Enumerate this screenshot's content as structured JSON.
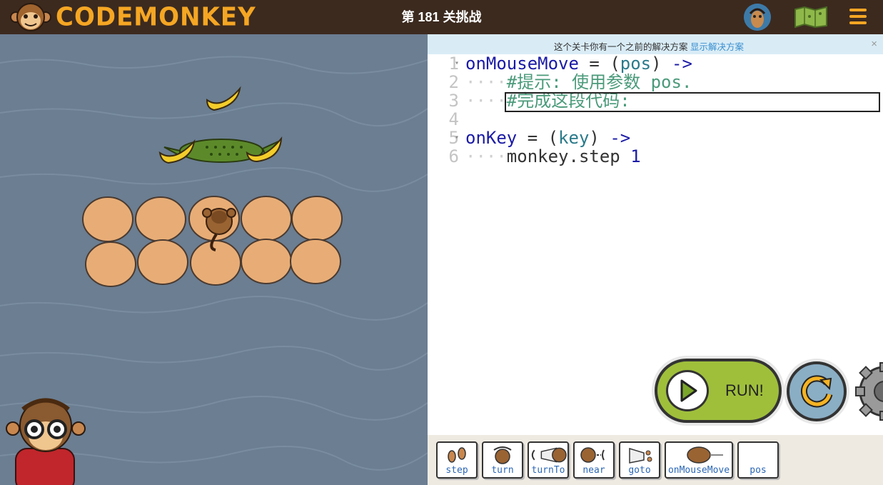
{
  "header": {
    "logo_text": "CODEMONKEY",
    "level_title": "第 181 关挑战",
    "icons": [
      "monkey-logo-icon",
      "profile-avatar-icon",
      "map-icon",
      "menu-icon"
    ],
    "accent_color": "#f5a623",
    "bar_color": "#3c2a1f"
  },
  "notice": {
    "message": "这个关卡你有一个之前的解决方案",
    "link": "显示解决方案",
    "close": "×"
  },
  "editor": {
    "lines": [
      {
        "num": "1",
        "fold": true,
        "parts": [
          [
            "onMouseMove",
            "kw-fn"
          ],
          [
            " = ",
            "op"
          ],
          [
            "(",
            "op"
          ],
          [
            "pos",
            "kw-par"
          ],
          [
            ")",
            "op"
          ],
          [
            " ",
            "op"
          ],
          [
            "->",
            "arrow"
          ]
        ]
      },
      {
        "num": "2",
        "fold": false,
        "parts": [
          [
            "····",
            "ws"
          ],
          [
            "#提示: 使用参数 pos.",
            "cm"
          ]
        ]
      },
      {
        "num": "3",
        "fold": false,
        "parts": [
          [
            "····",
            "ws"
          ],
          [
            "#完成这段代码:",
            "cm"
          ]
        ]
      },
      {
        "num": "4",
        "fold": false,
        "parts": []
      },
      {
        "num": "5",
        "fold": true,
        "parts": [
          [
            "onKey",
            "kw-fn"
          ],
          [
            " = ",
            "op"
          ],
          [
            "(",
            "op"
          ],
          [
            "key",
            "kw-par"
          ],
          [
            ")",
            "op"
          ],
          [
            " ",
            "op"
          ],
          [
            "->",
            "arrow"
          ]
        ]
      },
      {
        "num": "6",
        "fold": false,
        "parts": [
          [
            "····",
            "ws"
          ],
          [
            "monkey.step ",
            "op"
          ],
          [
            "1",
            "num"
          ]
        ]
      }
    ]
  },
  "controls": {
    "run_label": "RUN!",
    "run_color": "#9fbf3b",
    "reset_color": "#8aaec4"
  },
  "tray": {
    "tiles": [
      {
        "label": "step",
        "icon": "footprints-icon"
      },
      {
        "label": "turn",
        "icon": "turn-icon"
      },
      {
        "label": "turnTo",
        "icon": "turn-to-icon"
      },
      {
        "label": "near",
        "icon": "near-icon"
      },
      {
        "label": "goto",
        "icon": "goto-icon"
      },
      {
        "label": "onMouseMove",
        "icon": "mouse-icon"
      },
      {
        "label": "pos",
        "icon": ""
      }
    ]
  },
  "game": {
    "water_color": "#6b7e92",
    "sprites": [
      "banana-icon",
      "crocodile-icon",
      "turtle-icon",
      "monkey-icon",
      "guide-monkey-icon"
    ]
  }
}
